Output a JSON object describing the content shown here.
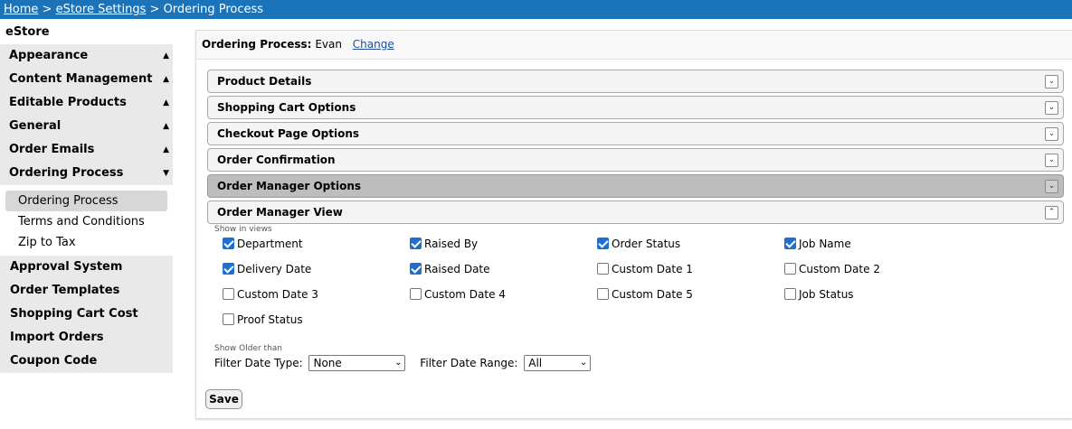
{
  "breadcrumb": {
    "home": "Home",
    "settings": "eStore Settings",
    "current": "Ordering Process",
    "separator": ">"
  },
  "sidebar": {
    "title": "eStore",
    "items_top": [
      {
        "label": "Appearance",
        "arrow": "▲"
      },
      {
        "label": "Content Management",
        "arrow": "▲"
      },
      {
        "label": "Editable Products",
        "arrow": "▲"
      },
      {
        "label": "General",
        "arrow": "▲"
      },
      {
        "label": "Order Emails",
        "arrow": "▲"
      },
      {
        "label": "Ordering Process",
        "arrow": "▼"
      }
    ],
    "subitems": [
      {
        "label": "Ordering Process",
        "active": true
      },
      {
        "label": "Terms and Conditions",
        "active": false
      },
      {
        "label": "Zip to Tax",
        "active": false
      }
    ],
    "items_bottom": [
      {
        "label": "Approval System"
      },
      {
        "label": "Order Templates"
      },
      {
        "label": "Shopping Cart Cost"
      },
      {
        "label": "Import Orders"
      },
      {
        "label": "Coupon Code"
      }
    ]
  },
  "main": {
    "header_label": "Ordering Process:",
    "header_value": "Evan",
    "change_link": "Change",
    "sections": [
      {
        "label": "Product Details",
        "toggle": "⌄"
      },
      {
        "label": "Shopping Cart Options",
        "toggle": "⌄"
      },
      {
        "label": "Checkout Page Options",
        "toggle": "⌄"
      },
      {
        "label": "Order Confirmation",
        "toggle": "⌄"
      },
      {
        "label": "Order Manager Options",
        "toggle": "⌄"
      },
      {
        "label": "Order Manager View",
        "toggle": "⌃"
      }
    ],
    "show_in_views_hint": "Show in views",
    "checkboxes": [
      {
        "label": "Department",
        "checked": true
      },
      {
        "label": "Raised By",
        "checked": true
      },
      {
        "label": "Order Status",
        "checked": true
      },
      {
        "label": "Job Name",
        "checked": true
      },
      {
        "label": "Delivery Date",
        "checked": true
      },
      {
        "label": "Raised Date",
        "checked": true
      },
      {
        "label": "Custom Date 1",
        "checked": false
      },
      {
        "label": "Custom Date 2",
        "checked": false
      },
      {
        "label": "Custom Date 3",
        "checked": false
      },
      {
        "label": "Custom Date 4",
        "checked": false
      },
      {
        "label": "Custom Date 5",
        "checked": false
      },
      {
        "label": "Job Status",
        "checked": false
      },
      {
        "label": "Proof Status",
        "checked": false
      }
    ],
    "show_older_hint": "Show Older than",
    "filter_date_type_label": "Filter Date Type:",
    "filter_date_type_value": "None",
    "filter_date_range_label": "Filter Date Range:",
    "filter_date_range_value": "All",
    "save_label": "Save"
  },
  "colors": {
    "breadcrumb_bg": "#1b73b9",
    "sidebar_bg": "#e9e9e9",
    "checkbox_checked": "#1e6fd0",
    "link": "#1b4f9c"
  }
}
